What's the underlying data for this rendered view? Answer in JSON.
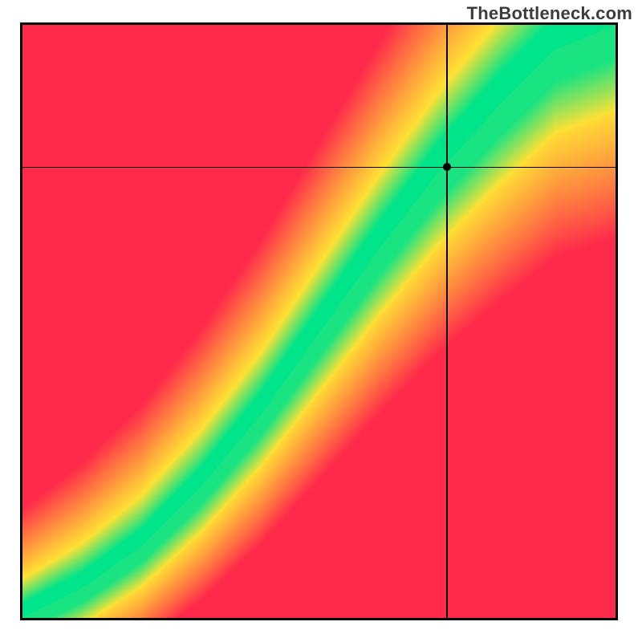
{
  "watermark": "TheBottleneck.com",
  "chart_data": {
    "type": "heatmap",
    "title": "",
    "xlabel": "",
    "ylabel": "",
    "xlim": [
      0,
      1
    ],
    "ylim": [
      0,
      1
    ],
    "crosshair": {
      "x": 0.716,
      "y": 0.76
    },
    "marker": {
      "x": 0.716,
      "y": 0.76
    },
    "colorscale": [
      {
        "stop": 0.0,
        "color": "#ff2a4a",
        "meaning": "high-bottleneck"
      },
      {
        "stop": 0.5,
        "color": "#ffe135",
        "meaning": "moderate"
      },
      {
        "stop": 1.0,
        "color": "#00e48a",
        "meaning": "optimal"
      }
    ],
    "optimal_ridge": [
      {
        "x": 0.0,
        "y": 0.0
      },
      {
        "x": 0.1,
        "y": 0.05
      },
      {
        "x": 0.2,
        "y": 0.12
      },
      {
        "x": 0.3,
        "y": 0.22
      },
      {
        "x": 0.4,
        "y": 0.34
      },
      {
        "x": 0.5,
        "y": 0.48
      },
      {
        "x": 0.6,
        "y": 0.62
      },
      {
        "x": 0.7,
        "y": 0.75
      },
      {
        "x": 0.8,
        "y": 0.86
      },
      {
        "x": 0.9,
        "y": 0.96
      },
      {
        "x": 1.0,
        "y": 1.0
      }
    ],
    "grid": false,
    "legend": null
  }
}
